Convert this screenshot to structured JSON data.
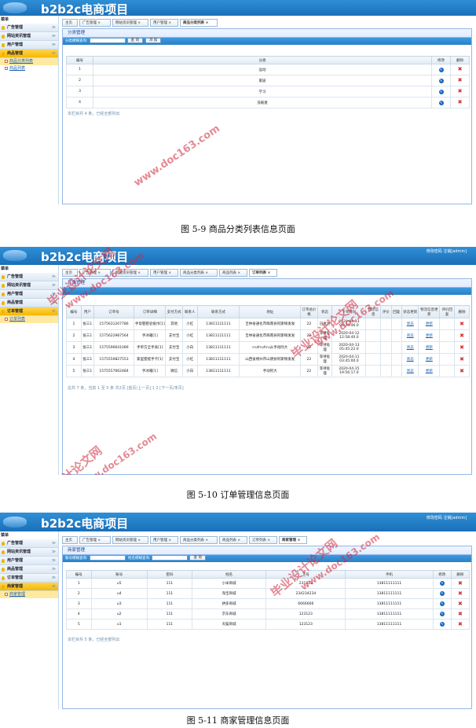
{
  "app_title": "b2b2c电商项目",
  "header_links": "修改密码 注销[admin]",
  "sidebar_caption": "菜单",
  "figures": [
    {
      "caption": "图 5-9 商品分类列表信息页面",
      "menus": [
        "广告管理",
        "网站资讯管理",
        "用户管理",
        "商品管理"
      ],
      "active_menu": "商品管理",
      "subitems": [
        "商品分类列表",
        "商品列表"
      ],
      "tabs": [
        "主页",
        "广告管理 ×",
        "网站资讯管理 ×",
        "用户管理 ×",
        "商品分类列表 ×"
      ],
      "panel_title": "分类管理",
      "search_label": "分类模糊查询:",
      "btn_search": "查 询",
      "btn_add": "添 加",
      "columns": [
        "编号",
        "分类",
        "修改",
        "删除"
      ],
      "rows": [
        [
          "1",
          "运动"
        ],
        [
          "2",
          "家居"
        ],
        [
          "3",
          "学习"
        ],
        [
          "4",
          "洗碗盘"
        ]
      ],
      "summary": "本栏目共 4 条，已经全部列出"
    },
    {
      "caption": "图 5-10 订单管理信息页面",
      "menus": [
        "广告管理",
        "网站资讯管理",
        "用户管理",
        "商品管理",
        "订单管理"
      ],
      "active_menu": "订单管理",
      "subitems": [
        "订单列表"
      ],
      "tabs": [
        "主页",
        "广告管理 ×",
        "网站资讯管理 ×",
        "用户管理 ×",
        "商品分类列表 ×",
        "商品列表 ×",
        "订单列表 ×"
      ],
      "panel_title": "订单管理",
      "columns": [
        "编号",
        "用户",
        "订单号",
        "订单详细",
        "支付方式",
        "联系人",
        "联系方式",
        "地址",
        "订单总价格",
        "状态",
        "下单时间",
        "物流信息",
        "评价",
        "回复",
        "状态更新",
        "物流信息更新",
        "评价回复",
        "删除"
      ],
      "rows": [
        [
          "1",
          "张三1",
          "1575631207786",
          "手母婴肥皂纸巾[1]",
          "其他",
          "小红",
          "13811111111",
          "吉林省通化市辉南县阿斯顿发发",
          "22",
          "已发货",
          "2020-04-13 05:24:46.0",
          "",
          "",
          "",
          "状态",
          "更新",
          "",
          ""
        ],
        [
          "2",
          "张三1",
          "1575622987564",
          "手冰箱[1]",
          "支付宝",
          "小红",
          "13811111111",
          "吉林省通化市辉南县阿斯顿发发",
          "22",
          "等待处理",
          "2020-04-12 12:58:40.0",
          "",
          "",
          "",
          "状态",
          "更新",
          "",
          ""
        ],
        [
          "3",
          "张三1",
          "1575596641089",
          "手单方全手表[1]",
          "支付宝",
          "小白",
          "13811111111",
          "rrufrrufrru从手动阿大",
          "22",
          "等待处理",
          "2020-04-13 05:45:22.0",
          "",
          "",
          "",
          "状态",
          "更新",
          "",
          ""
        ],
        [
          "4",
          "张三1",
          "1575559827553",
          "家里婴提手卡[1]",
          "支付宝",
          "小红",
          "13811111111",
          "山西省朔州市山阴县阿斯顿发发",
          "22",
          "等待处理",
          "2020-04-11 03:45:00.0",
          "",
          "",
          "",
          "状态",
          "更新",
          "",
          ""
        ],
        [
          "5",
          "张三1",
          "1575557662484",
          "手冰箱[1]",
          "微信",
          "小白",
          "13811111111",
          "手动阿大",
          "22",
          "等待处理",
          "2020-04-15 19:56:17.0",
          "",
          "",
          "",
          "状态",
          "更新",
          "",
          ""
        ]
      ],
      "summary": "总共 7 条，当前 1 至 5 条 共2页 [首页/上一页] 1 2 [下一页/末页]"
    },
    {
      "caption": "图 5-11 商家管理信息页面",
      "menus": [
        "广告管理",
        "网站资讯管理",
        "用户管理",
        "商品管理",
        "订单管理",
        "商家管理"
      ],
      "active_menu": "商家管理",
      "subitems": [
        "商家管理"
      ],
      "tabs": [
        "主页",
        "广告管理 ×",
        "网站资讯管理 ×",
        "用户管理 ×",
        "商品分类列表 ×",
        "商品列表 ×",
        "订单列表 ×",
        "商家管理 ×"
      ],
      "panel_title": "商家管理",
      "search_label": "账号模糊查询:",
      "search_label2": "姓名模糊查询:",
      "btn_search": "查 询",
      "columns": [
        "编号",
        "账号",
        "密码",
        "姓名",
        "卫号",
        "手机",
        "修改",
        "删除"
      ],
      "rows": [
        [
          "1",
          "u5",
          "111",
          "小米商城",
          "231213",
          "13811111111"
        ],
        [
          "2",
          "u4",
          "111",
          "淘宝商城",
          "234234234",
          "13811111111"
        ],
        [
          "3",
          "u3",
          "111",
          "拼多商城",
          "6666666",
          "13811111111"
        ],
        [
          "4",
          "u2",
          "111",
          "京东商城",
          "123123",
          "13811111111"
        ],
        [
          "5",
          "u1",
          "111",
          "天猫商城",
          "123123",
          "13811111111"
        ]
      ],
      "summary": "本栏目共 5 条，已经全部列出"
    }
  ],
  "watermark_cn": "毕业设计论文网",
  "watermark_url": "www.doc163.com",
  "colors": {
    "header": "#1f7cc3",
    "bar": "#2f8bd2",
    "delete": "#d32f2f",
    "edit": "#1565c0",
    "active_menu": "#f5b800"
  }
}
